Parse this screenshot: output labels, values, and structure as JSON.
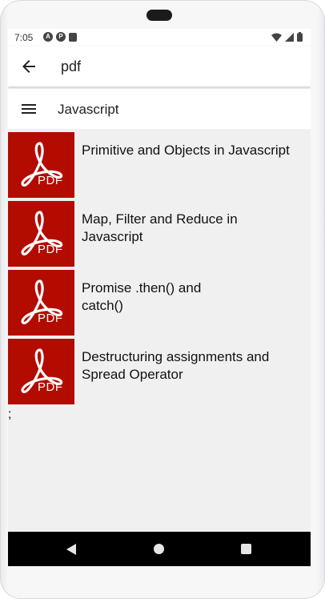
{
  "status_bar": {
    "time": "7:05",
    "left_icons": [
      "a-icon",
      "p-icon",
      "sim-icon"
    ],
    "right_icons": [
      "wifi-icon",
      "signal-icon",
      "battery-icon"
    ]
  },
  "app_bar": {
    "title": "pdf",
    "back_icon": "arrow-back-icon"
  },
  "section": {
    "title": "Javascript",
    "menu_icon": "hamburger-menu-icon"
  },
  "documents": [
    {
      "title": "Primitive and Objects in Javascript",
      "thumb_label": "PDF"
    },
    {
      "title": "Map, Filter and Reduce in Javascript",
      "thumb_label": "PDF"
    },
    {
      "title": "Promise .then() and catch()",
      "thumb_label": "PDF"
    },
    {
      "title": "Destructuring assignments and Spread Operator",
      "thumb_label": "PDF"
    }
  ],
  "stray_text": ";",
  "colors": {
    "pdf_red": "#b30b00",
    "screen_bg": "#f0f0f0",
    "nav_bar": "#000000"
  }
}
